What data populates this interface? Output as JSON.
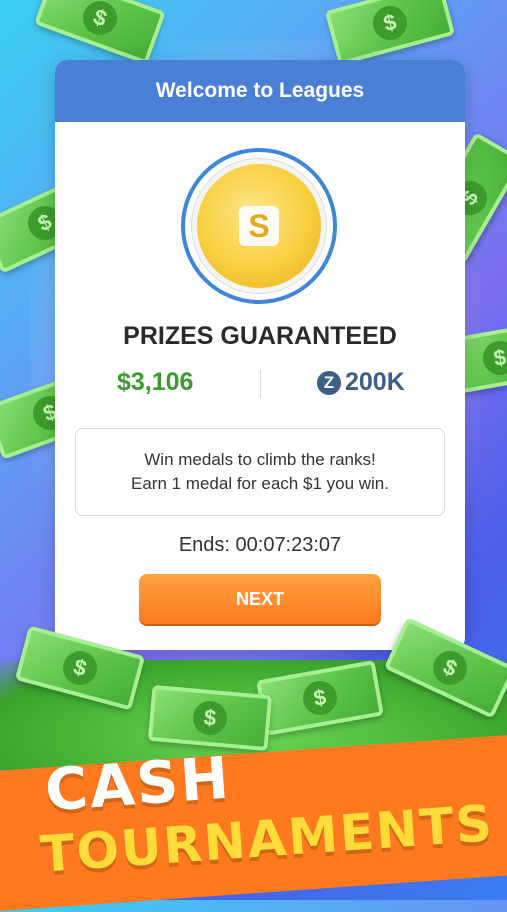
{
  "header": {
    "title": "Welcome to Leagues"
  },
  "medal": {
    "icon": "s-medal-icon",
    "letter": "S"
  },
  "prizes": {
    "title": "PRIZES GUARANTEED",
    "cash_amount": "$3,106",
    "z_icon": "Z",
    "z_amount": "200K"
  },
  "info": {
    "line1": "Win medals to climb the ranks!",
    "line2": "Earn 1 medal for each $1 you win."
  },
  "timer": {
    "text": "Ends: 00:07:23:07"
  },
  "buttons": {
    "next_label": "NEXT"
  },
  "banner": {
    "line1": "CASH",
    "line2": "TOURNAMENTS"
  },
  "colors": {
    "header_blue": "#4a7fd6",
    "cash_green": "#3d9a2f",
    "z_blue": "#3d5f84",
    "next_orange": "#ff8a25",
    "banner_orange": "#ff7a1e",
    "banner_yellow": "#ffdc3a"
  }
}
